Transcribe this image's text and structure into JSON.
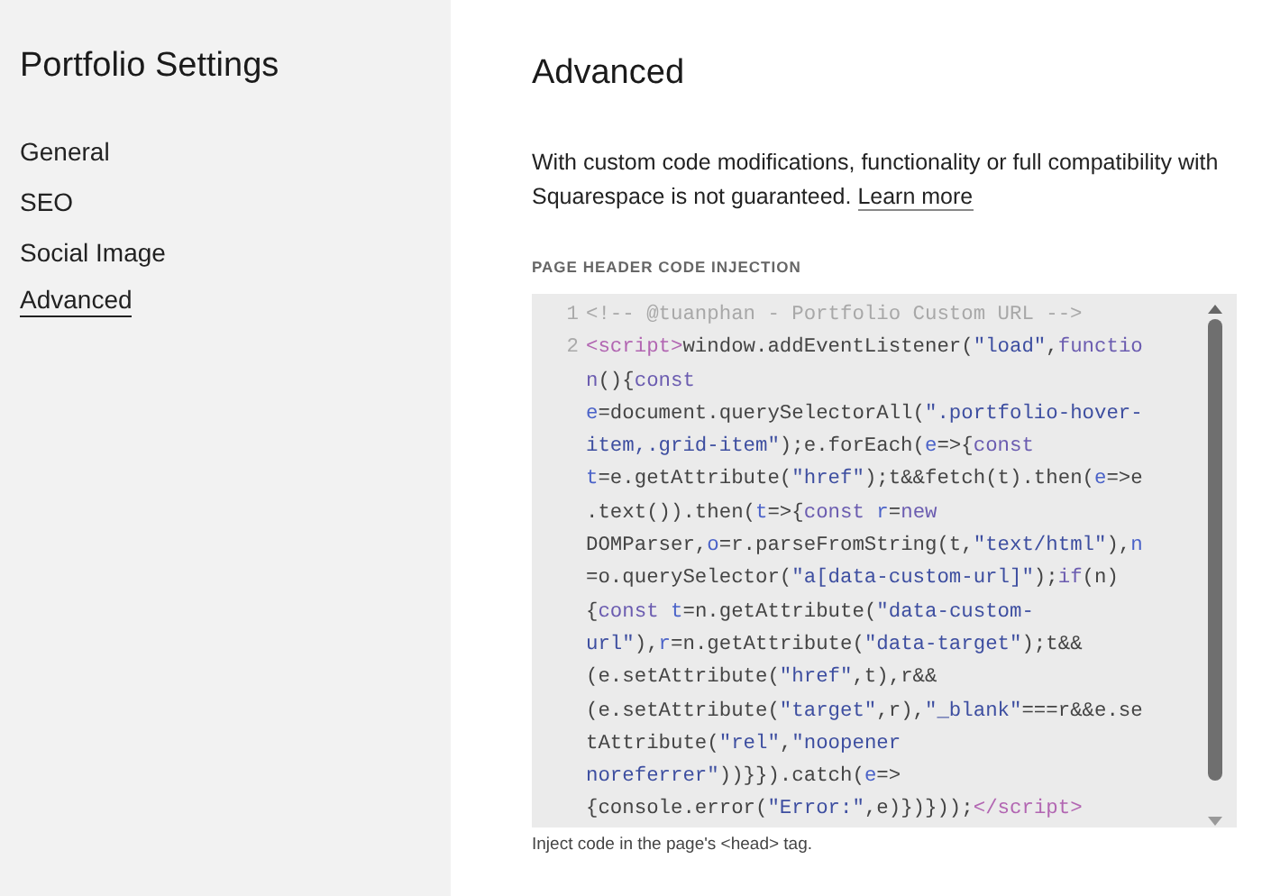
{
  "sidebar": {
    "title": "Portfolio Settings",
    "items": [
      {
        "label": "General",
        "selected": false
      },
      {
        "label": "SEO",
        "selected": false
      },
      {
        "label": "Social Image",
        "selected": false
      },
      {
        "label": "Advanced",
        "selected": true
      }
    ]
  },
  "main": {
    "heading": "Advanced",
    "notice": "With custom code modifications, functionality or full compatibility with Squarespace is not guaranteed.",
    "notice_link": "Learn more",
    "field_label": "PAGE HEADER CODE INJECTION",
    "code_lines": [
      {
        "number": "1",
        "rows": [
          {
            "segments": [
              {
                "kind": "comment",
                "text": "<!-- @tuanphan - Portfolio Custom URL -->"
              }
            ]
          }
        ]
      },
      {
        "number": "2",
        "rows": [
          {
            "segments": [
              {
                "kind": "tag",
                "text": "<script>"
              },
              {
                "kind": "plain",
                "text": "window.addEventListener("
              },
              {
                "kind": "string",
                "text": "\"load\""
              },
              {
                "kind": "plain",
                "text": ","
              },
              {
                "kind": "keyword",
                "text": "functio"
              }
            ]
          },
          {
            "segments": [
              {
                "kind": "keyword",
                "text": "n"
              },
              {
                "kind": "plain",
                "text": "(){"
              },
              {
                "kind": "keyword",
                "text": "const"
              }
            ]
          },
          {
            "segments": [
              {
                "kind": "variable",
                "text": "e"
              },
              {
                "kind": "plain",
                "text": "=document.querySelectorAll("
              },
              {
                "kind": "string",
                "text": "\".portfolio-hover-"
              }
            ]
          },
          {
            "segments": [
              {
                "kind": "string",
                "text": "item,.grid-item\""
              },
              {
                "kind": "plain",
                "text": ");e.forEach("
              },
              {
                "kind": "variable",
                "text": "e"
              },
              {
                "kind": "plain",
                "text": "=>{"
              },
              {
                "kind": "keyword",
                "text": "const"
              }
            ]
          },
          {
            "segments": [
              {
                "kind": "variable",
                "text": "t"
              },
              {
                "kind": "plain",
                "text": "=e.getAttribute("
              },
              {
                "kind": "string",
                "text": "\"href\""
              },
              {
                "kind": "plain",
                "text": ");t&&fetch(t).then("
              },
              {
                "kind": "variable",
                "text": "e"
              },
              {
                "kind": "plain",
                "text": "=>e"
              }
            ]
          },
          {
            "segments": [
              {
                "kind": "plain",
                "text": ".text()).then("
              },
              {
                "kind": "variable",
                "text": "t"
              },
              {
                "kind": "plain",
                "text": "=>{"
              },
              {
                "kind": "keyword",
                "text": "const"
              },
              {
                "kind": "variable",
                "text": " r"
              },
              {
                "kind": "plain",
                "text": "="
              },
              {
                "kind": "keyword",
                "text": "new"
              }
            ]
          },
          {
            "segments": [
              {
                "kind": "plain",
                "text": "DOMParser,"
              },
              {
                "kind": "variable",
                "text": "o"
              },
              {
                "kind": "plain",
                "text": "=r.parseFromString(t,"
              },
              {
                "kind": "string",
                "text": "\"text/html\""
              },
              {
                "kind": "plain",
                "text": "),"
              },
              {
                "kind": "variable",
                "text": "n"
              }
            ]
          },
          {
            "segments": [
              {
                "kind": "plain",
                "text": "=o.querySelector("
              },
              {
                "kind": "string",
                "text": "\"a[data-custom-url]\""
              },
              {
                "kind": "plain",
                "text": ");"
              },
              {
                "kind": "keyword",
                "text": "if"
              },
              {
                "kind": "plain",
                "text": "(n)"
              }
            ]
          },
          {
            "segments": [
              {
                "kind": "plain",
                "text": "{"
              },
              {
                "kind": "keyword",
                "text": "const"
              },
              {
                "kind": "variable",
                "text": " t"
              },
              {
                "kind": "plain",
                "text": "=n.getAttribute("
              },
              {
                "kind": "string",
                "text": "\"data-custom-"
              }
            ]
          },
          {
            "segments": [
              {
                "kind": "string",
                "text": "url\""
              },
              {
                "kind": "plain",
                "text": "),"
              },
              {
                "kind": "variable",
                "text": "r"
              },
              {
                "kind": "plain",
                "text": "=n.getAttribute("
              },
              {
                "kind": "string",
                "text": "\"data-target\""
              },
              {
                "kind": "plain",
                "text": ");t&&"
              }
            ]
          },
          {
            "segments": [
              {
                "kind": "plain",
                "text": "(e.setAttribute("
              },
              {
                "kind": "string",
                "text": "\"href\""
              },
              {
                "kind": "plain",
                "text": ",t),r&&"
              }
            ]
          },
          {
            "segments": [
              {
                "kind": "plain",
                "text": "(e.setAttribute("
              },
              {
                "kind": "string",
                "text": "\"target\""
              },
              {
                "kind": "plain",
                "text": ",r),"
              },
              {
                "kind": "string",
                "text": "\"_blank\""
              },
              {
                "kind": "plain",
                "text": "===r&&e.se"
              }
            ]
          },
          {
            "segments": [
              {
                "kind": "plain",
                "text": "tAttribute("
              },
              {
                "kind": "string",
                "text": "\"rel\""
              },
              {
                "kind": "plain",
                "text": ","
              },
              {
                "kind": "string",
                "text": "\"noopener"
              }
            ]
          },
          {
            "segments": [
              {
                "kind": "string",
                "text": "noreferrer\""
              },
              {
                "kind": "plain",
                "text": "))}}).catch("
              },
              {
                "kind": "variable",
                "text": "e"
              },
              {
                "kind": "plain",
                "text": "=>"
              }
            ]
          },
          {
            "segments": [
              {
                "kind": "plain",
                "text": "{console.error("
              },
              {
                "kind": "string",
                "text": "\"Error:\""
              },
              {
                "kind": "plain",
                "text": ",e)})}));"
              },
              {
                "kind": "tag",
                "text": "</script>"
              }
            ]
          }
        ]
      }
    ],
    "hint": "Inject code in the page's <head> tag."
  }
}
